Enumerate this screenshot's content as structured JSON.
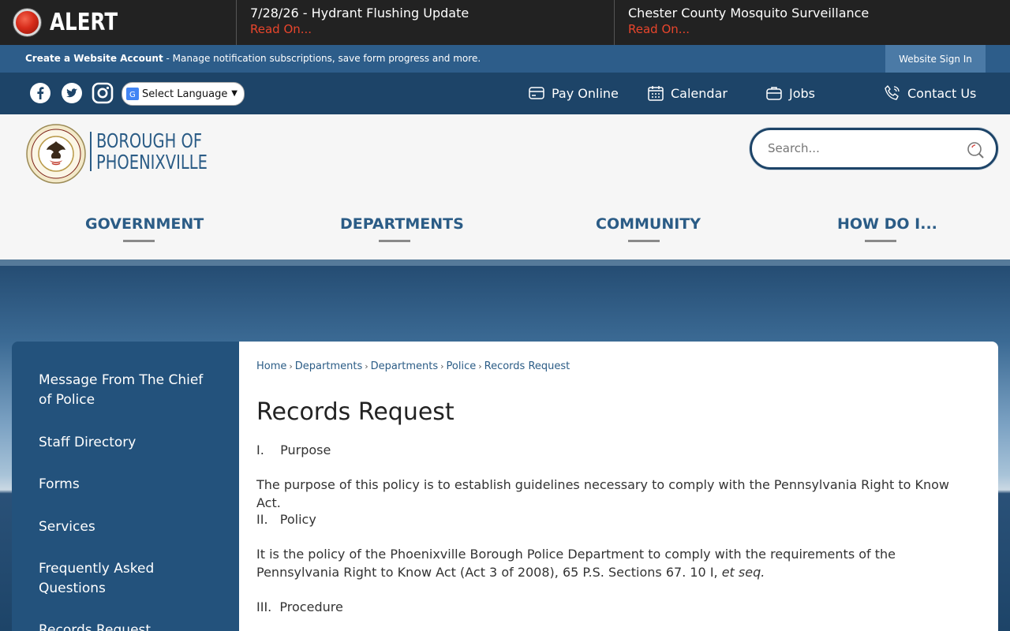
{
  "alert": {
    "label": "ALERT",
    "items": [
      {
        "title": "7/28/26 - Hydrant Flushing Update",
        "link": "Read On..."
      },
      {
        "title": "Chester County Mosquito Surveillance",
        "link": "Read On..."
      }
    ]
  },
  "account": {
    "create_label": "Create a Website Account",
    "create_desc": " - Manage notification subscriptions, save form progress and more.",
    "signin_label": "Website Sign In"
  },
  "utility": {
    "language_label": "Select Language",
    "links": [
      {
        "label": "Pay Online",
        "icon": "credit-card-icon"
      },
      {
        "label": "Calendar",
        "icon": "calendar-icon"
      },
      {
        "label": "Jobs",
        "icon": "briefcase-icon"
      },
      {
        "label": "Contact Us",
        "icon": "phone-icon"
      }
    ]
  },
  "header": {
    "logo_line1": "BOROUGH OF",
    "logo_line2": "PHOENIXVILLE",
    "search_placeholder": "Search..."
  },
  "nav": [
    {
      "label": "GOVERNMENT"
    },
    {
      "label": "DEPARTMENTS"
    },
    {
      "label": "COMMUNITY"
    },
    {
      "label": "HOW DO I..."
    }
  ],
  "sidebar": {
    "items": [
      {
        "label": "Message From The Chief of Police"
      },
      {
        "label": "Staff Directory"
      },
      {
        "label": "Forms"
      },
      {
        "label": "Services"
      },
      {
        "label": "Frequently Asked Questions"
      },
      {
        "label": "Records Request"
      }
    ]
  },
  "breadcrumb": [
    "Home",
    "Departments",
    "Departments",
    "Police",
    "Records Request"
  ],
  "content": {
    "title": "Records Request",
    "purpose_heading": "I.    Purpose",
    "purpose_text": "The purpose of this policy is to establish guidelines necessary to comply with the Pennsylvania Right to Know Act.",
    "policy_heading": "II.   Policy",
    "policy_text": "It is the policy of the Phoenixville Borough Police Department to comply with the requirements of the Pennsylvania Right to Know Act (Act 3 of 2008), 65 P.S. Sections 67. 10 I, ",
    "policy_italic": "et seq.",
    "procedure_heading": "III.  Procedure"
  },
  "colors": {
    "alert_bg": "#222222",
    "alert_red": "#e8452c",
    "account_bar": "#2d5d8a",
    "utility_bar": "#1d4468",
    "brand_blue": "#2b5c86",
    "sidebar_bg": "#23527c"
  }
}
